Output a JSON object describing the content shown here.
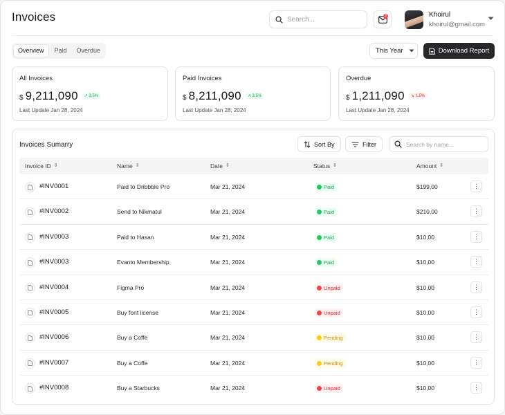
{
  "header": {
    "title": "Invoices",
    "search_placeholder": "Search...",
    "notification_count": "3",
    "user": {
      "name": "Khoirul",
      "email": "khoirul@gmail.com"
    }
  },
  "tabs": [
    {
      "label": "Overview",
      "active": true
    },
    {
      "label": "Paid",
      "active": false
    },
    {
      "label": "Overdue",
      "active": false
    }
  ],
  "period_select": "This Year",
  "download_label": "Download Report",
  "stats": [
    {
      "title": "All Invoices",
      "currency": "$",
      "value": "9,211,090",
      "trend": "3.5%",
      "direction": "up",
      "updated": "Last Update Jan 28, 2024"
    },
    {
      "title": "Paid Invoices",
      "currency": "$",
      "value": "8,211,090",
      "trend": "3.5%",
      "direction": "up",
      "updated": "Last Update Jan 28, 2024"
    },
    {
      "title": "Overdue",
      "currency": "$",
      "value": "1,211,090",
      "trend": "1.5%",
      "direction": "down",
      "updated": "Last Update Jan 28, 2024"
    }
  ],
  "table": {
    "title": "Invoices Sumarry",
    "sort_label": "Sort By",
    "filter_label": "Filter",
    "search_placeholder": "Search by name...",
    "columns": [
      "Invoice ID",
      "Name",
      "Date",
      "Status",
      "Amount"
    ],
    "rows": [
      {
        "id": "#INV0001",
        "name": "Paid to Dribbble Pro",
        "date": "Mar 21, 2024",
        "status": "Paid",
        "amount": "$199,00"
      },
      {
        "id": "#INV0002",
        "name": "Send to Nikmatul",
        "date": "Mar 21, 2024",
        "status": "Paid",
        "amount": "$210,00"
      },
      {
        "id": "#INV0003",
        "name": "Paid to Hasan",
        "date": "Mar 21, 2024",
        "status": "Paid",
        "amount": "$10,00"
      },
      {
        "id": "#INV0003",
        "name": "Evanto Membership",
        "date": "Mar 21, 2024",
        "status": "Paid",
        "amount": "$10,00"
      },
      {
        "id": "#INV0004",
        "name": "Figma Pro",
        "date": "Mar 21, 2024",
        "status": "Unpaid",
        "amount": "$10,00"
      },
      {
        "id": "#INV0005",
        "name": "Buy font license",
        "date": "Mar 21, 2024",
        "status": "Unpaid",
        "amount": "$10,00"
      },
      {
        "id": "#INV0006",
        "name": "Buy a Coffe",
        "date": "Mar 21, 2024",
        "status": "Pending",
        "amount": "$10,00"
      },
      {
        "id": "#INV0007",
        "name": "Buy a Coffe",
        "date": "Mar 21, 2024",
        "status": "Pending",
        "amount": "$10,00"
      },
      {
        "id": "#INV0008",
        "name": "Buy a Starbucks",
        "date": "Mar 21, 2024",
        "status": "Unpaid",
        "amount": "$10,00"
      }
    ]
  },
  "status_colors": {
    "Paid": {
      "text": "#16a34a",
      "bg": "#ecfdf3",
      "dot": "#22c55e"
    },
    "Unpaid": {
      "text": "#dc2626",
      "bg": "#fef2f2",
      "dot": "#ef4444"
    },
    "Pending": {
      "text": "#ca8a04",
      "bg": "#fefce8",
      "dot": "#facc15"
    }
  },
  "icons": {
    "search": "search-icon",
    "mail": "mail-icon",
    "caret": "chevron-down-icon",
    "download": "file-download-icon",
    "sort": "sort-arrows-icon",
    "filter": "filter-lines-icon",
    "file": "file-icon",
    "more": "more-vertical-icon"
  }
}
